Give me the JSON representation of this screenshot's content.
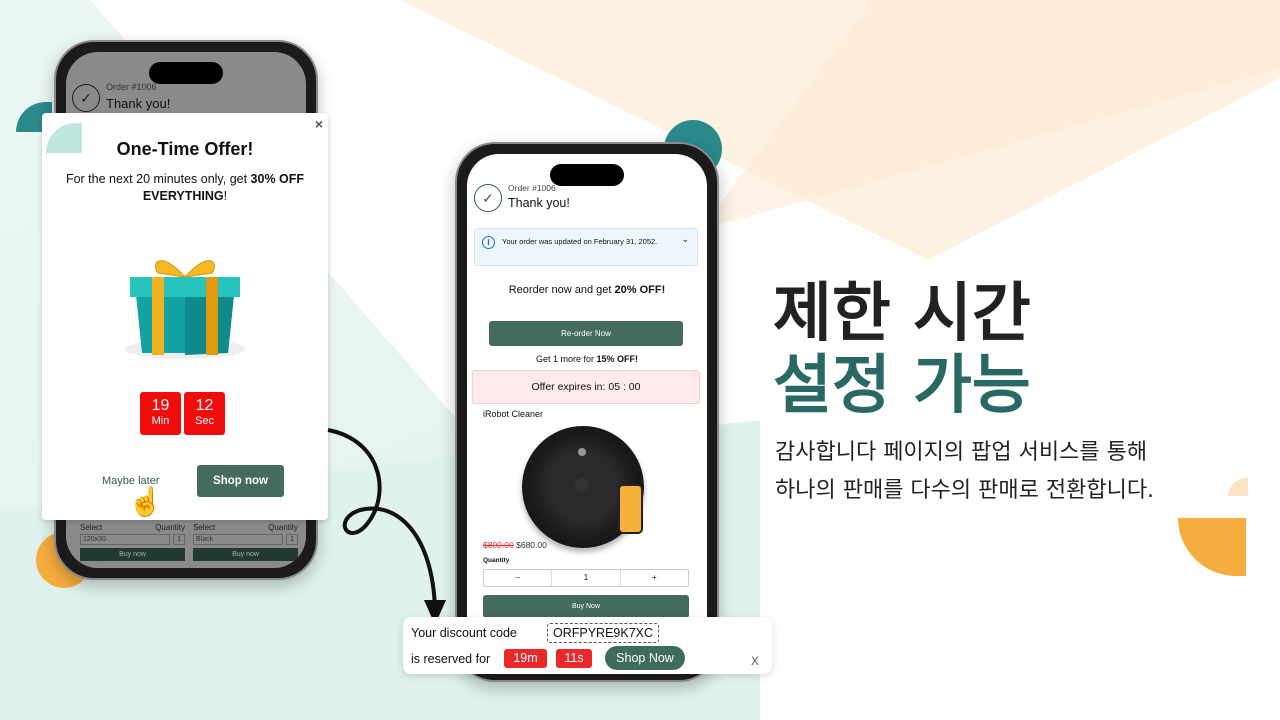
{
  "colors": {
    "accent_green": "#446b5e",
    "headline_teal": "#2a6866",
    "timer_red": "#f20d0d",
    "orange": "#f6ad3f",
    "teal_circle": "#2b8a8a"
  },
  "left_phone": {
    "order_number": "Order #1006",
    "thank_you": "Thank you!",
    "popup": {
      "title": "One-Time Offer!",
      "body_prefix": "For the next 20 minutes only, get ",
      "body_bold": "30% OFF EVERYTHING",
      "body_suffix": "!",
      "close_icon": "close-icon",
      "image": "gift-box",
      "timer": [
        {
          "value": "19",
          "unit": "Min"
        },
        {
          "value": "12",
          "unit": "Sec"
        }
      ],
      "maybe_later": "Maybe later",
      "shop_now": "Shop now"
    },
    "bg_products": [
      {
        "select_label": "Select",
        "select_value": "120x30",
        "qty_label": "Quantity",
        "qty": "1",
        "buy": "Buy now"
      },
      {
        "select_label": "Select",
        "select_value": "Black",
        "qty_label": "Quantity",
        "qty": "1",
        "buy": "Buy now"
      }
    ]
  },
  "center_phone": {
    "order_number": "Order #1006",
    "thank_you": "Thank you!",
    "notice": "Your order was updated on February 31, 2052.",
    "reorder_prefix": "Reorder now and get ",
    "reorder_bold": "20% OFF!",
    "reorder_button": "Re-order Now",
    "more_prefix": "Get 1 more for ",
    "more_bold": "15% OFF!",
    "expires": "Offer expires in: 05 : 00",
    "product_name": "iRobot Cleaner",
    "old_price": "$800.00",
    "new_price": "$680.00",
    "quantity_label": "Quantity",
    "minus": "−",
    "qty": "1",
    "plus": "+",
    "buy_now": "Buy Now"
  },
  "discount_bar": {
    "line1": "Your discount code",
    "code": "ORFPYRE9K7XC",
    "line2": "is reserved for",
    "minutes": "19m",
    "seconds": "11s",
    "shop_now": "Shop Now",
    "close": "X"
  },
  "headline": {
    "line1": "제한 시간",
    "line2": "설정 가능",
    "sub1": "감사합니다 페이지의 팝업 서비스를 통해",
    "sub2": "하나의 판매를 다수의 판매로 전환합니다."
  }
}
